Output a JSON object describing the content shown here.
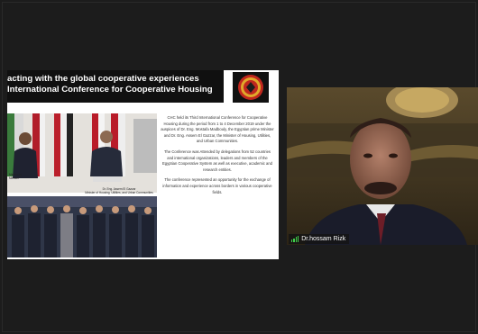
{
  "slide": {
    "title_line1": "acting with the global cooperative experiences",
    "title_line2": "International Conference for Cooperative Housing",
    "caption_left_1": "Madbouly",
    "caption_left_2": "Minister",
    "caption_right_1": "Dr. Eng. Assem El Gazzar",
    "caption_right_2": "Minister of Housing, Utilities, and Urban Communities",
    "paragraphs": [
      "CHC held its Third International Conference for Cooperative Housing during the period from 1 to 4 December 2019 under the auspices of Dr. Eng. Mostafa Madbouly, the Egyptian prime Minister and Dr. Eng. Assem El Gazzar, the Minister of Housing, Utilities, and Urban Communities.",
      "The Conference was Attended by delegations from 52 countries and international organizations, leaders and members of the Egyptian Cooperative System as well as executive, academic and research entities.",
      "The conference represented an opportunity for the exchange of information and experience across borders in various cooperative fields."
    ]
  },
  "camera": {
    "participant_name": "Dr.hossam Rizk",
    "signal_icon": "signal-bars-icon"
  },
  "colors": {
    "background": "#1c1c1c",
    "signal": "#3fd14a",
    "logo_red": "#c0271e",
    "logo_gold": "#e0a92b"
  }
}
